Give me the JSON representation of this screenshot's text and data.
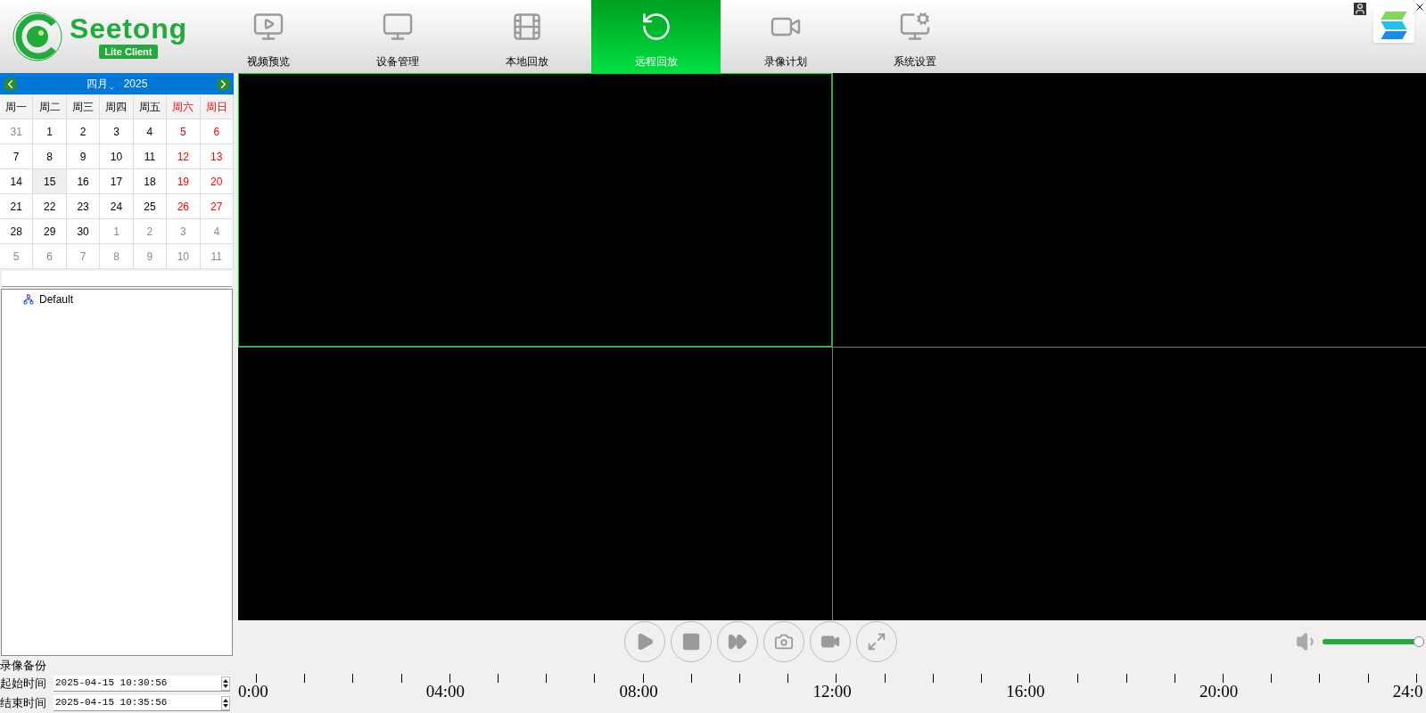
{
  "logo": {
    "name": "Seetong",
    "badge": "Lite Client"
  },
  "tabs": [
    {
      "label": "视频预览",
      "kind": "preview",
      "selected": false
    },
    {
      "label": "设备管理",
      "kind": "device",
      "selected": false
    },
    {
      "label": "本地回放",
      "kind": "local",
      "selected": false
    },
    {
      "label": "远程回放",
      "kind": "remote",
      "selected": true
    },
    {
      "label": "录像计划",
      "kind": "schedule",
      "selected": false
    },
    {
      "label": "系统设置",
      "kind": "settings",
      "selected": false
    }
  ],
  "calendar": {
    "month": "四月",
    "year": "2025",
    "weekdays": [
      {
        "label": "周一",
        "weekend": false
      },
      {
        "label": "周二",
        "weekend": false
      },
      {
        "label": "周三",
        "weekend": false
      },
      {
        "label": "周四",
        "weekend": false
      },
      {
        "label": "周五",
        "weekend": false
      },
      {
        "label": "周六",
        "weekend": true
      },
      {
        "label": "周日",
        "weekend": true
      }
    ],
    "days": [
      {
        "label": "31",
        "kind": "other",
        "selected": false
      },
      {
        "label": "1",
        "kind": "day",
        "selected": false
      },
      {
        "label": "2",
        "kind": "day",
        "selected": false
      },
      {
        "label": "3",
        "kind": "day",
        "selected": false
      },
      {
        "label": "4",
        "kind": "day",
        "selected": false
      },
      {
        "label": "5",
        "kind": "weekend",
        "selected": false
      },
      {
        "label": "6",
        "kind": "weekend",
        "selected": false
      },
      {
        "label": "7",
        "kind": "day",
        "selected": false
      },
      {
        "label": "8",
        "kind": "day",
        "selected": false
      },
      {
        "label": "9",
        "kind": "day",
        "selected": false
      },
      {
        "label": "10",
        "kind": "day",
        "selected": false
      },
      {
        "label": "11",
        "kind": "day",
        "selected": false
      },
      {
        "label": "12",
        "kind": "weekend",
        "selected": false
      },
      {
        "label": "13",
        "kind": "weekend",
        "selected": false
      },
      {
        "label": "14",
        "kind": "day",
        "selected": false
      },
      {
        "label": "15",
        "kind": "day",
        "selected": true
      },
      {
        "label": "16",
        "kind": "day",
        "selected": false
      },
      {
        "label": "17",
        "kind": "day",
        "selected": false
      },
      {
        "label": "18",
        "kind": "day",
        "selected": false
      },
      {
        "label": "19",
        "kind": "weekend",
        "selected": false
      },
      {
        "label": "20",
        "kind": "weekend",
        "selected": false
      },
      {
        "label": "21",
        "kind": "day",
        "selected": false
      },
      {
        "label": "22",
        "kind": "day",
        "selected": false
      },
      {
        "label": "23",
        "kind": "day",
        "selected": false
      },
      {
        "label": "24",
        "kind": "day",
        "selected": false
      },
      {
        "label": "25",
        "kind": "day",
        "selected": false
      },
      {
        "label": "26",
        "kind": "weekend",
        "selected": false
      },
      {
        "label": "27",
        "kind": "weekend",
        "selected": false
      },
      {
        "label": "28",
        "kind": "day",
        "selected": false
      },
      {
        "label": "29",
        "kind": "day",
        "selected": false
      },
      {
        "label": "30",
        "kind": "day",
        "selected": false
      },
      {
        "label": "1",
        "kind": "other",
        "selected": false
      },
      {
        "label": "2",
        "kind": "other",
        "selected": false
      },
      {
        "label": "3",
        "kind": "other",
        "selected": false
      },
      {
        "label": "4",
        "kind": "other",
        "selected": false
      },
      {
        "label": "5",
        "kind": "other",
        "selected": false
      },
      {
        "label": "6",
        "kind": "other",
        "selected": false
      },
      {
        "label": "7",
        "kind": "other",
        "selected": false
      },
      {
        "label": "8",
        "kind": "other",
        "selected": false
      },
      {
        "label": "9",
        "kind": "other",
        "selected": false
      },
      {
        "label": "10",
        "kind": "other",
        "selected": false
      },
      {
        "label": "11",
        "kind": "other",
        "selected": false
      }
    ]
  },
  "tree": [
    {
      "label": "Default"
    }
  ],
  "backup": {
    "title": "录像备份",
    "fields": [
      {
        "label": "起始时间",
        "value": "2025-04-15 10:30:56"
      },
      {
        "label": "结束时间",
        "value": "2025-04-15 10:35:56"
      }
    ]
  },
  "video_cells": [
    {
      "selected": true
    },
    {
      "selected": false
    },
    {
      "selected": false
    },
    {
      "selected": false
    }
  ],
  "controls": [
    {
      "kind": "play"
    },
    {
      "kind": "stop"
    },
    {
      "kind": "fast"
    },
    {
      "kind": "snapshot"
    },
    {
      "kind": "record"
    },
    {
      "kind": "fullscreen"
    }
  ],
  "volume": {
    "level": 1
  },
  "timeline": {
    "labels": [
      "0:00",
      "04:00",
      "08:00",
      "12:00",
      "16:00",
      "20:00",
      "24:0"
    ]
  }
}
